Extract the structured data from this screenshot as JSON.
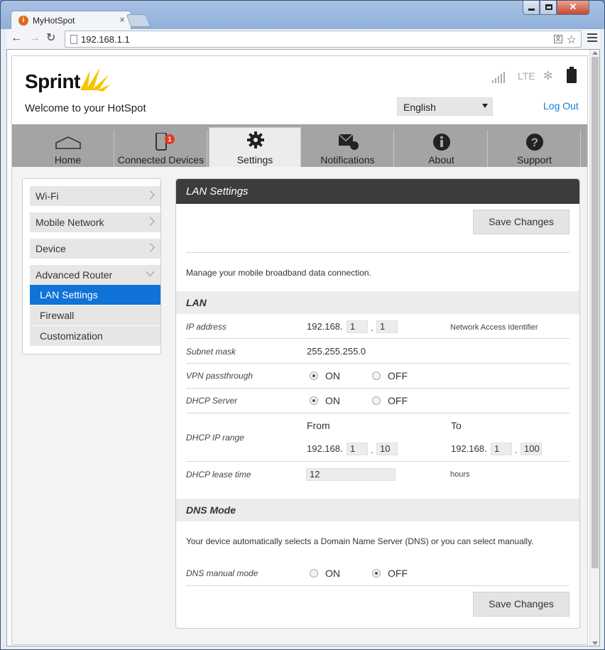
{
  "browser": {
    "tab_title": "MyHotSpot",
    "tab_close": "×",
    "url": "192.168.1.1"
  },
  "header": {
    "brand": "Sprint",
    "welcome": "Welcome to your HotSpot",
    "network_type": "LTE",
    "language": "English",
    "logout": "Log Out"
  },
  "nav": {
    "items": [
      {
        "label": "Home"
      },
      {
        "label": "Connected Devices",
        "badge": "1"
      },
      {
        "label": "Settings"
      },
      {
        "label": "Notifications"
      },
      {
        "label": "About"
      },
      {
        "label": "Support"
      }
    ],
    "active": "Settings"
  },
  "sidebar": {
    "items": [
      "Wi-Fi",
      "Mobile Network",
      "Device",
      "Advanced Router"
    ],
    "subitems": [
      "LAN Settings",
      "Firewall",
      "Customization"
    ],
    "active_sub": "LAN Settings"
  },
  "panel": {
    "title": "LAN Settings",
    "save_label": "Save Changes",
    "intro": "Manage your mobile broadband data connection.",
    "lan": {
      "heading": "LAN",
      "ip_label": "IP address",
      "ip_prefix": "192.168.",
      "ip_oct3": "1",
      "ip_oct4": "1",
      "nai_label": "Network Access Identifier",
      "subnet_label": "Subnet mask",
      "subnet_value": "255.255.255.0",
      "vpn_label": "VPN passthrough",
      "dhcp_server_label": "DHCP Server",
      "on_label": "ON",
      "off_label": "OFF",
      "vpn_value": "ON",
      "dhcp_server_value": "ON",
      "range_label": "DHCP IP range",
      "from_label": "From",
      "to_label": "To",
      "from_prefix": "192.168.",
      "from_oct3": "1",
      "from_oct4": "10",
      "to_prefix": "192.168.",
      "to_oct3": "1",
      "to_oct4": "100",
      "lease_label": "DHCP lease time",
      "lease_value": "12",
      "lease_unit": "hours",
      "dot": "."
    },
    "dns": {
      "heading": "DNS Mode",
      "desc": "Your device automatically selects a Domain Name Server (DNS) or you can select manually.",
      "manual_label": "DNS manual mode",
      "value": "OFF"
    }
  }
}
